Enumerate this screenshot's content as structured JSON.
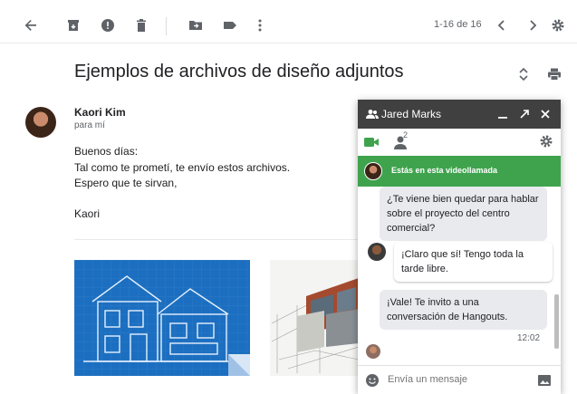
{
  "toolbar": {
    "icons": [
      "back-arrow-icon",
      "archive-icon",
      "report-spam-icon",
      "delete-icon",
      "move-to-icon",
      "label-icon",
      "more-vert-icon"
    ],
    "pager": "1-16 de 16",
    "nav": [
      "chevron-left-icon",
      "chevron-right-icon",
      "settings-gear-icon"
    ]
  },
  "email": {
    "subject": "Ejemplos de archivos de diseño adjuntos",
    "sender": "Kaori Kim",
    "to": "para mí",
    "body": [
      "Buenos días:",
      "Tal como te prometí, te envío estos archivos.",
      "Espero que te sirvan,",
      "Kaori"
    ]
  },
  "chat": {
    "title": "Jared Marks",
    "people_count": "2",
    "banner": "Estás en esta videollamada",
    "messages": [
      "¿Te viene bien quedar para hablar sobre el proyecto del centro comercial?",
      "¡Claro que sí! Tengo toda la tarde libre.",
      "¡Vale! Te invito a una conversación de Hangouts."
    ],
    "time": "12:02",
    "input_placeholder": "Envía un mensaje"
  },
  "colors": {
    "chat_header": "#404040",
    "banner_green": "#3fa34d",
    "video_icon_green": "#3fa34d",
    "blueprint_blue": "#1c6fc0"
  }
}
